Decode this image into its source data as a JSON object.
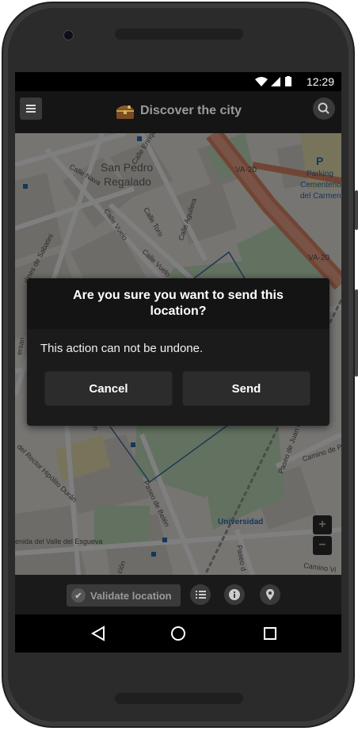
{
  "status_bar": {
    "time": "12:29"
  },
  "app_bar": {
    "title": "Discover the city"
  },
  "map": {
    "labels": {
      "district": "San Pedro",
      "district2": "Regalado",
      "calle_enrique_leon": "Calle Enrique León",
      "calle_nava": "Calle Nava",
      "calle_vuelo_1": "Calle Vuelo",
      "calle_vuelo_2": "Calle Vuelo",
      "calle_toro": "Calle Toro",
      "calle_aguilera": "Calle Aguilera",
      "sabatini": "dines de Sabatini",
      "va20_a": "VA-20",
      "va20_b": "VA-20",
      "parking_p": "P",
      "parking": "Parking",
      "cementerio": "Cementerio",
      "carmen": "del Carmen",
      "versan": "ersan",
      "camino_pal": "Camino de Pal",
      "paseo_juan_c": "Paseo de Juan C",
      "rector": "del Rector Hipólito Durán",
      "paseo_belen": "Paseo de Belén",
      "universidad": "Universidad",
      "valle_esgueva": "enida del Valle del Esgueva",
      "camino_vi": "Camino Vi",
      "paseo_2": "Paseo d",
      "cion": "ción",
      "len": "len"
    },
    "zoom_in": "+",
    "zoom_out": "−"
  },
  "dialog": {
    "title": "Are you sure you want to send this location?",
    "message": "This action can not be undone.",
    "cancel": "Cancel",
    "send": "Send"
  },
  "bottom_bar": {
    "validate": "Validate location"
  },
  "icons": {
    "menu": "menu-icon",
    "search": "search-icon",
    "chest": "treasure-chest-icon",
    "check": "check-icon",
    "list": "list-icon",
    "info": "info-icon",
    "pin": "map-pin-icon",
    "back": "back-icon",
    "home": "home-icon",
    "recents": "recents-icon"
  },
  "colors": {
    "accent": "#e38a6b",
    "dialog_bg": "#1b1b1b",
    "appbar": "#151515"
  }
}
